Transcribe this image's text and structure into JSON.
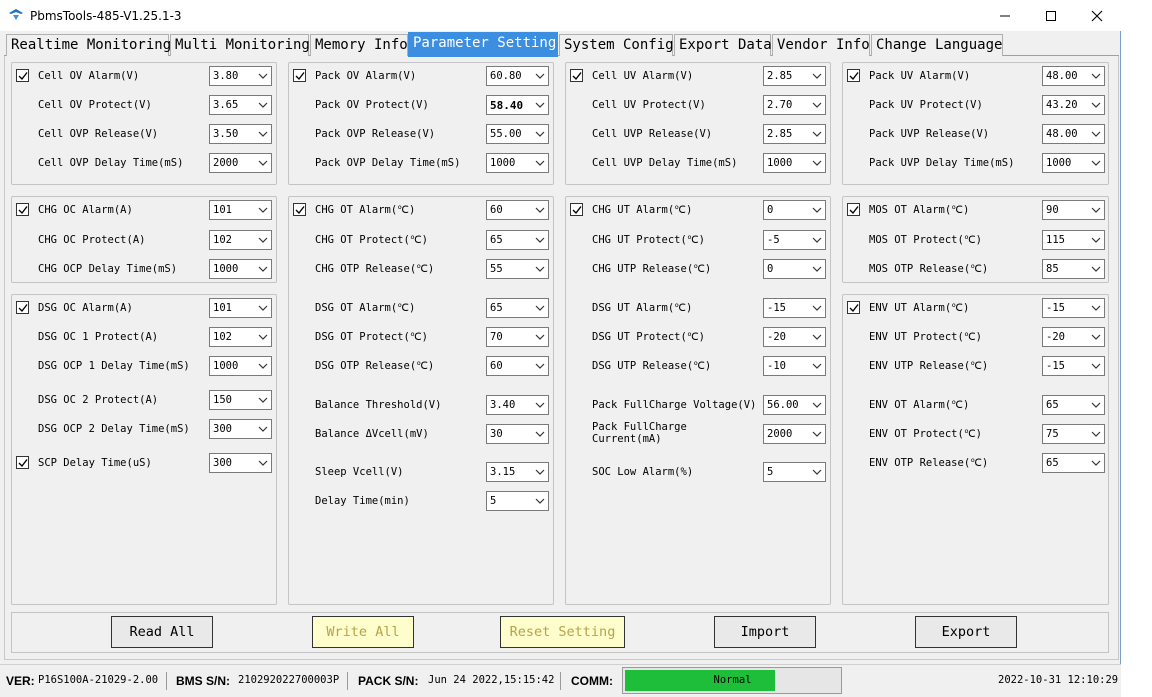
{
  "window": {
    "title": "PbmsTools-485-V1.25.1-3"
  },
  "tabs": [
    "Realtime Monitoring",
    "Multi Monitoring",
    "Memory Info",
    "Parameter Setting",
    "System Config",
    "Export Data",
    "Vendor Info",
    "Change Language"
  ],
  "active_tab": "Parameter Setting",
  "col1": {
    "g1": [
      {
        "label": "Cell OV Alarm(V)",
        "value": "3.80",
        "checked": true
      },
      {
        "label": "Cell OV Protect(V)",
        "value": "3.65"
      },
      {
        "label": "Cell OVP Release(V)",
        "value": "3.50"
      },
      {
        "label": "Cell OVP Delay Time(mS)",
        "value": "2000"
      }
    ],
    "g2": [
      {
        "label": "CHG OC Alarm(A)",
        "value": "101",
        "checked": true
      },
      {
        "label": "CHG OC Protect(A)",
        "value": "102"
      },
      {
        "label": "CHG OCP Delay Time(mS)",
        "value": "1000"
      }
    ],
    "g3": [
      {
        "label": "DSG OC Alarm(A)",
        "value": "101",
        "checked": true
      },
      {
        "label": "DSG OC 1 Protect(A)",
        "value": "102"
      },
      {
        "label": "DSG OCP 1 Delay Time(mS)",
        "value": "1000"
      },
      {
        "label": "DSG OC 2 Protect(A)",
        "value": "150"
      },
      {
        "label": "DSG OCP 2 Delay Time(mS)",
        "value": "300"
      },
      {
        "label": "SCP Delay Time(uS)",
        "value": "300",
        "checked": true
      }
    ]
  },
  "col2": {
    "g1": [
      {
        "label": "Pack OV Alarm(V)",
        "value": "60.80",
        "checked": true
      },
      {
        "label": "Pack OV Protect(V)",
        "value": "58.40",
        "bold": true
      },
      {
        "label": "Pack OVP Release(V)",
        "value": "55.00"
      },
      {
        "label": "Pack OVP Delay Time(mS)",
        "value": "1000"
      }
    ],
    "g2": [
      {
        "label": "CHG OT Alarm(℃)",
        "value": "60",
        "checked": true
      },
      {
        "label": "CHG OT Protect(℃)",
        "value": "65"
      },
      {
        "label": "CHG OTP Release(℃)",
        "value": "55"
      },
      {
        "label": "DSG OT Alarm(℃)",
        "value": "65"
      },
      {
        "label": "DSG OT Protect(℃)",
        "value": "70"
      },
      {
        "label": "DSG OTP Release(℃)",
        "value": "60"
      },
      {
        "label": "Balance Threshold(V)",
        "value": "3.40"
      },
      {
        "label": "Balance ΔVcell(mV)",
        "value": "30"
      },
      {
        "label": "Sleep Vcell(V)",
        "value": "3.15"
      },
      {
        "label": "Delay Time(min)",
        "value": "5"
      }
    ]
  },
  "col3": {
    "g1": [
      {
        "label": "Cell UV Alarm(V)",
        "value": "2.85",
        "checked": true
      },
      {
        "label": "Cell UV Protect(V)",
        "value": "2.70"
      },
      {
        "label": "Cell UVP Release(V)",
        "value": "2.85"
      },
      {
        "label": "Cell UVP Delay Time(mS)",
        "value": "1000"
      }
    ],
    "g2": [
      {
        "label": "CHG UT Alarm(℃)",
        "value": "0",
        "checked": true
      },
      {
        "label": "CHG UT Protect(℃)",
        "value": "-5"
      },
      {
        "label": "CHG UTP Release(℃)",
        "value": "0"
      },
      {
        "label": "DSG UT Alarm(℃)",
        "value": "-15"
      },
      {
        "label": "DSG UT Protect(℃)",
        "value": "-20"
      },
      {
        "label": "DSG UTP Release(℃)",
        "value": "-10"
      },
      {
        "label": "Pack FullCharge Voltage(V)",
        "value": "56.00"
      },
      {
        "label_l1": "Pack FullCharge",
        "label_l2": "Current(mA)",
        "value": "2000"
      },
      {
        "label": "SOC Low Alarm(%)",
        "value": "5"
      }
    ]
  },
  "col4": {
    "g1": [
      {
        "label": "Pack UV Alarm(V)",
        "value": "48.00",
        "checked": true
      },
      {
        "label": "Pack UV Protect(V)",
        "value": "43.20"
      },
      {
        "label": "Pack UVP Release(V)",
        "value": "48.00"
      },
      {
        "label": "Pack UVP Delay Time(mS)",
        "value": "1000"
      }
    ],
    "g2": [
      {
        "label": "MOS OT Alarm(℃)",
        "value": "90",
        "checked": true
      },
      {
        "label": "MOS OT Protect(℃)",
        "value": "115"
      },
      {
        "label": "MOS OTP Release(℃)",
        "value": "85"
      }
    ],
    "g3": [
      {
        "label": "ENV UT Alarm(℃)",
        "value": "-15",
        "checked": true
      },
      {
        "label": "ENV UT Protect(℃)",
        "value": "-20"
      },
      {
        "label": "ENV UTP Release(℃)",
        "value": "-15"
      },
      {
        "label": "ENV OT Alarm(℃)",
        "value": "65"
      },
      {
        "label": "ENV OT Protect(℃)",
        "value": "75"
      },
      {
        "label": "ENV OTP Release(℃)",
        "value": "65"
      }
    ]
  },
  "buttons": {
    "read_all": "Read All",
    "write_all": "Write All",
    "reset_setting": "Reset Setting",
    "import": "Import",
    "export": "Export"
  },
  "status": {
    "ver_key": "VER:",
    "ver": "P16S100A-21029-2.00",
    "bms_key": "BMS S/N:",
    "bms_sn": "210292022700003P",
    "pack_key": "PACK S/N:",
    "pack_sn": "Jun 24 2022,15:15:42",
    "comm_key": "COMM:",
    "comm": "Normal",
    "comm_progress": 0.7,
    "datetime": "2022-10-31  12:10:29"
  },
  "colors": {
    "accent": "#3b8ee0",
    "comm_ok": "#1ebe3a",
    "disabled_text": "#b7a34c"
  }
}
